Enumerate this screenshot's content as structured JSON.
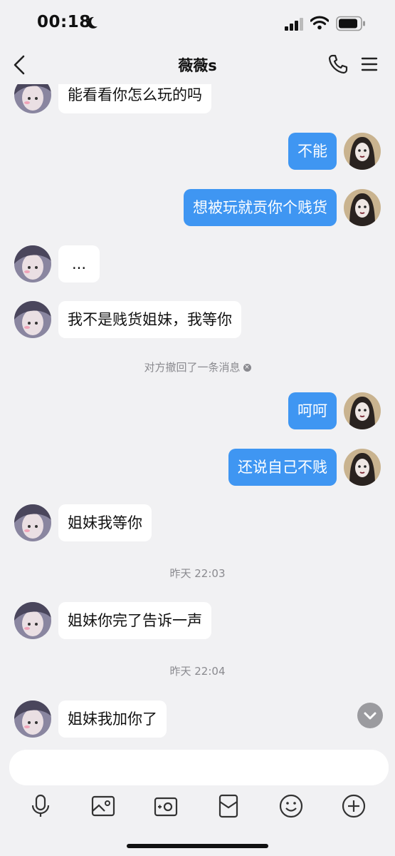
{
  "status": {
    "time": "00:18"
  },
  "header": {
    "title": "薇薇s"
  },
  "messages": [
    {
      "side": "left",
      "text": "能看看你怎么玩的吗"
    },
    {
      "side": "right",
      "text": "不能"
    },
    {
      "side": "right",
      "text": "想被玩就贡你个贱货"
    },
    {
      "side": "left",
      "text": "..."
    },
    {
      "side": "left",
      "text": "我不是贱货姐妹，我等你"
    },
    {
      "side": "right",
      "text": "呵呵"
    },
    {
      "side": "right",
      "text": "还说自己不贱"
    },
    {
      "side": "left",
      "text": "姐妹我等你"
    },
    {
      "side": "left",
      "text": "姐妹你完了告诉一声"
    },
    {
      "side": "left",
      "text": "姐妹我加你了"
    }
  ],
  "system": {
    "recall": "对方撤回了一条消息",
    "time1": "昨天 22:03",
    "time2": "昨天 22:04"
  },
  "colors": {
    "accent": "#3f96f2",
    "background": "#f1f1f3",
    "bubble_in": "#ffffff"
  },
  "icons": [
    "moon-icon",
    "signal-icon",
    "wifi-icon",
    "battery-icon",
    "back-icon",
    "phone-icon",
    "menu-icon",
    "mic-icon",
    "image-icon",
    "camera-icon",
    "red-packet-icon",
    "emoji-icon",
    "plus-icon",
    "chevron-down-icon"
  ]
}
